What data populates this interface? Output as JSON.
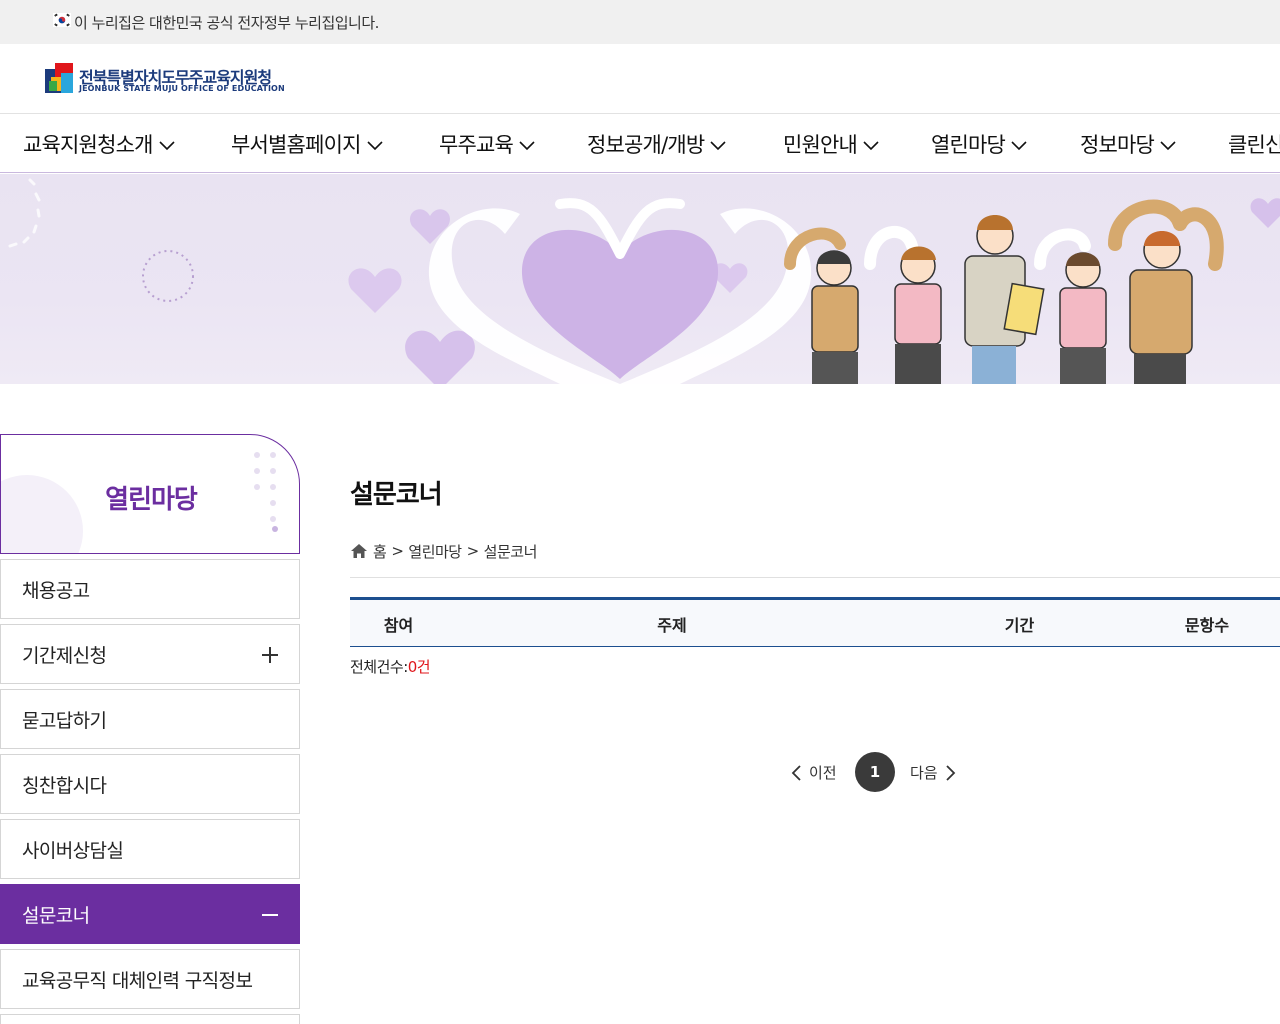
{
  "gov_bar": {
    "text": "이 누리집은 대한민국 공식 전자정부 누리집입니다."
  },
  "logo": {
    "name_ko": "전북특별자치도무주교육지원청",
    "name_en": "JEONBUK STATE MUJU OFFICE OF EDUCATION"
  },
  "gnb": {
    "items": [
      {
        "label": "교육지원청소개"
      },
      {
        "label": "부서별홈페이지"
      },
      {
        "label": "무주교육"
      },
      {
        "label": "정보공개/개방"
      },
      {
        "label": "민원안내"
      },
      {
        "label": "열린마당"
      },
      {
        "label": "정보마당"
      },
      {
        "label": "클린신"
      }
    ]
  },
  "lnb": {
    "title": "열린마당",
    "items": [
      {
        "label": "채용공고",
        "sign": ""
      },
      {
        "label": "기간제신청",
        "sign": "plus"
      },
      {
        "label": "묻고답하기",
        "sign": ""
      },
      {
        "label": "칭찬합시다",
        "sign": ""
      },
      {
        "label": "사이버상담실",
        "sign": ""
      },
      {
        "label": "설문코너",
        "sign": "minus",
        "active": true
      },
      {
        "label": "교육공무직 대체인력 구직정보",
        "sign": ""
      }
    ]
  },
  "content": {
    "title": "설문코너",
    "breadcrumb": {
      "home": "홈",
      "sep": ">",
      "level1": "열린마당",
      "level2": "설문코너"
    },
    "table": {
      "headers": [
        "참여",
        "주제",
        "기간",
        "문항수"
      ]
    },
    "total": {
      "label": "전체건수:",
      "count": "0건"
    },
    "pagination": {
      "prev": "이전",
      "current": "1",
      "next": "다음"
    }
  },
  "colors": {
    "accent": "#6b2ea0",
    "table_border": "#1c4f8f",
    "count": "#e0161b",
    "banner_bg": "#e9e3f2"
  }
}
